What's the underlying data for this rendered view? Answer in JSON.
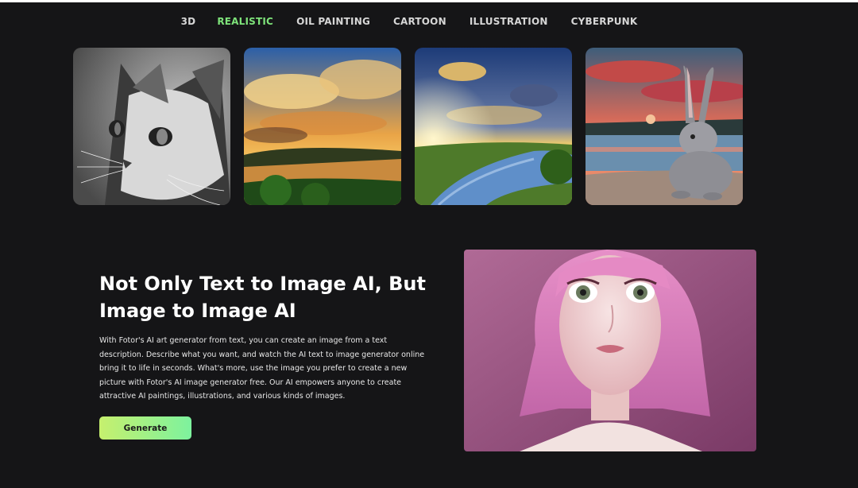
{
  "style_tabs": {
    "items": [
      {
        "label": "3D",
        "active": false
      },
      {
        "label": "REALISTIC",
        "active": true
      },
      {
        "label": "OIL PAINTING",
        "active": false
      },
      {
        "label": "CARTOON",
        "active": false
      },
      {
        "label": "ILLUSTRATION",
        "active": false
      },
      {
        "label": "CYBERPUNK",
        "active": false
      }
    ],
    "active_color": "#7ee37a"
  },
  "gallery": {
    "images": [
      {
        "subject": "black-and-white cat close-up"
      },
      {
        "subject": "river under dramatic sunset clouds"
      },
      {
        "subject": "sunburst over winding river"
      },
      {
        "subject": "grey rabbit by lake at sunset"
      }
    ]
  },
  "feature": {
    "headline": "Not Only Text to Image AI, But Image to Image AI",
    "description": "With Fotor's AI art generator from text, you can create an image from a text description. Describe what you want, and watch the AI text to image generator online bring it to life in seconds. What's more, use the image you prefer to create a new picture with Fotor's AI image generator free. Our AI empowers anyone to create attractive AI paintings, illustrations, and various kinds of images.",
    "button_label": "Generate",
    "image_subject": "pink-haired girl portrait"
  },
  "colors": {
    "background": "#151517",
    "button_gradient_start": "#c6f06e",
    "button_gradient_end": "#7df29e"
  }
}
